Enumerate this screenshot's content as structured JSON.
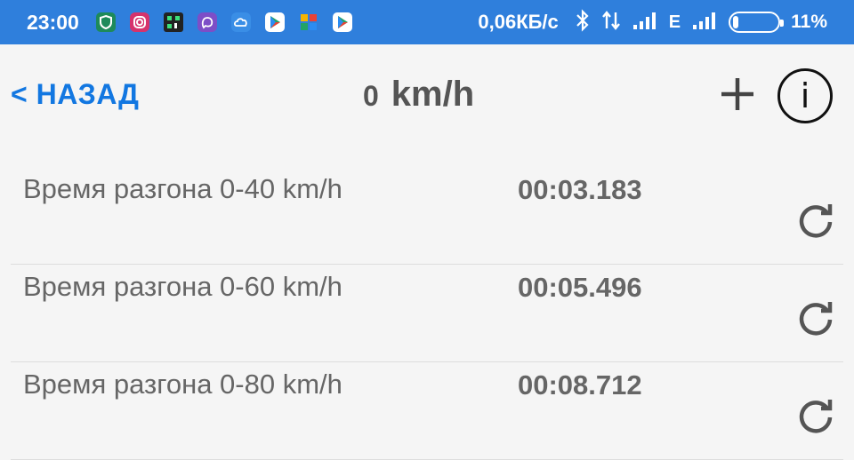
{
  "status_bar": {
    "time": "23:00",
    "app_icons": [
      "shield-app-icon",
      "instagram-icon",
      "qr-app-icon",
      "viber-icon",
      "cloud-icon",
      "play-store-icon",
      "puzzle-icon",
      "play-store-icon"
    ],
    "net_speed": "0,06КБ/с",
    "network_type": "E",
    "battery_percent": "11%",
    "battery_level": 0.11,
    "accent_color": "#2f7fdc"
  },
  "nav": {
    "back_label": "< НАЗАД",
    "speed_value": "0",
    "speed_unit": "km/h",
    "link_color": "#1277e1"
  },
  "rows": [
    {
      "label": "Время разгона  0-40 km/h",
      "time": "00:03.183"
    },
    {
      "label": "Время разгона  0-60 km/h",
      "time": "00:05.496"
    },
    {
      "label": "Время разгона  0-80 km/h",
      "time": "00:08.712"
    }
  ]
}
